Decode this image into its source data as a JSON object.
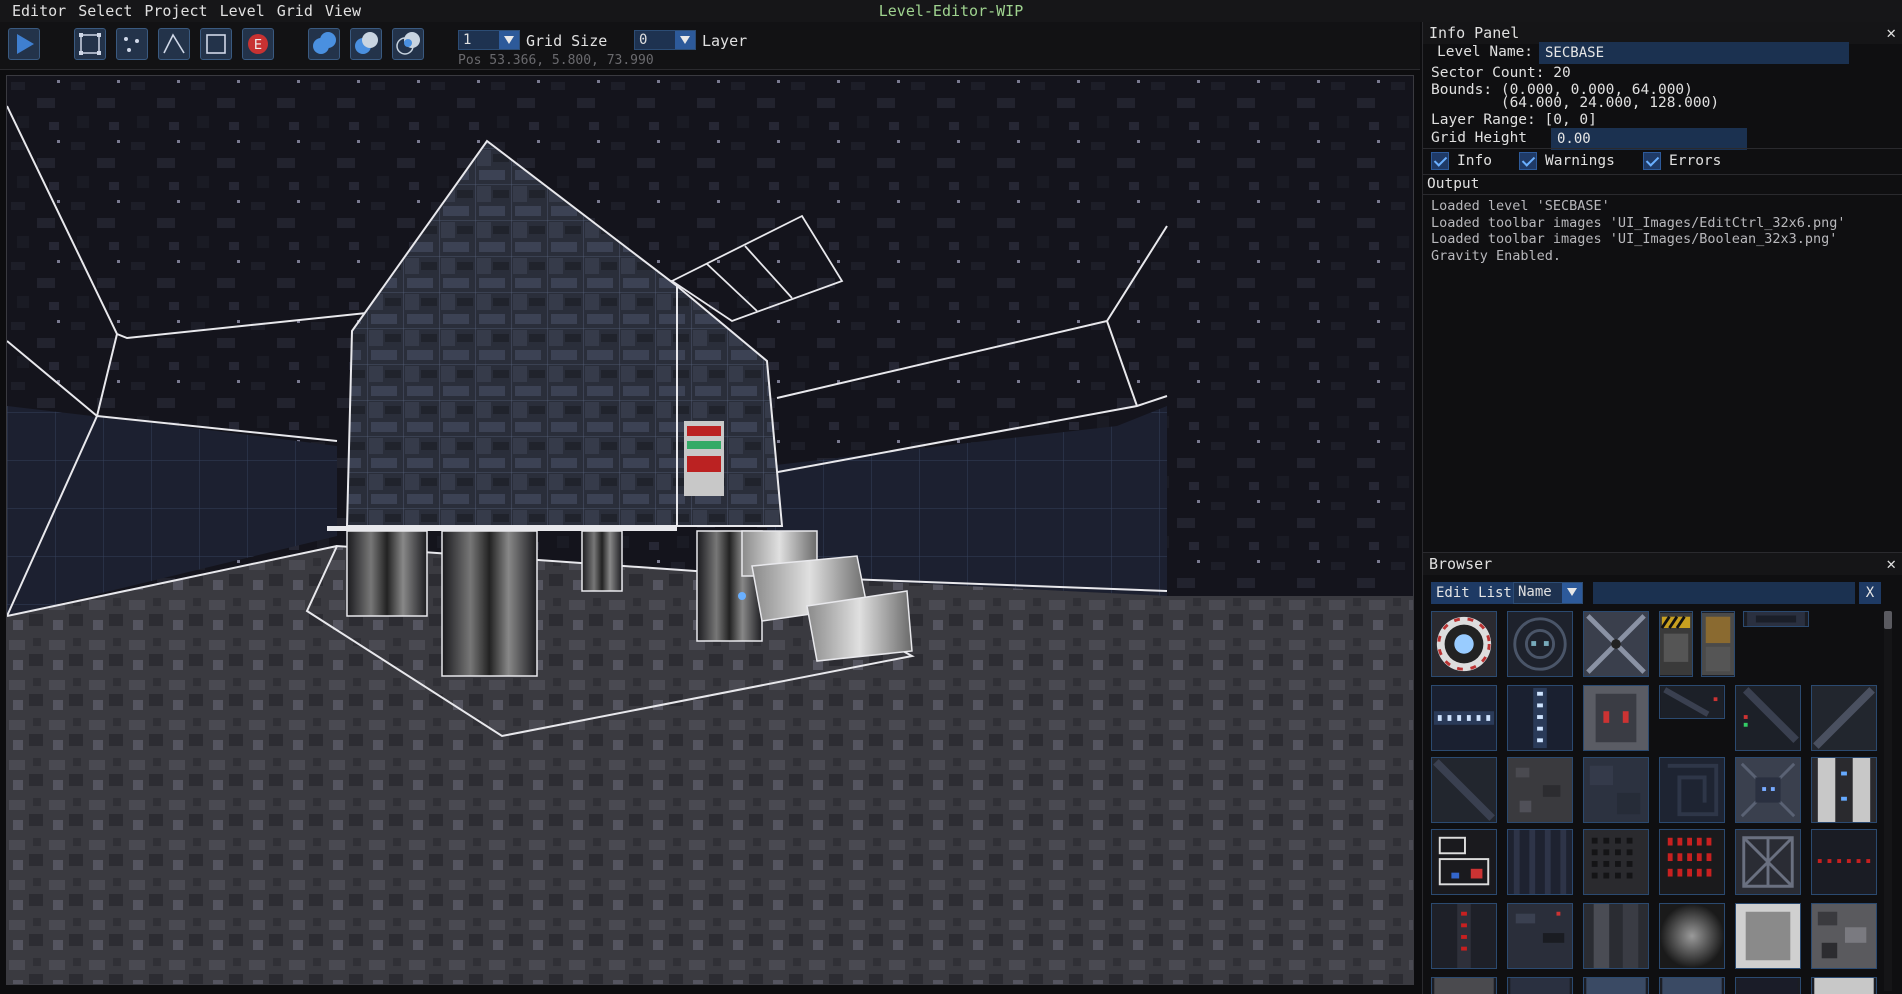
{
  "app": {
    "title": "Level-Editor-WIP"
  },
  "menu": [
    "Editor",
    "Select",
    "Project",
    "Level",
    "Grid",
    "View"
  ],
  "toolbar": {
    "grid_size_value": "1",
    "grid_size_label": "Grid Size",
    "layer_value": "0",
    "layer_label": "Layer",
    "position_readout": "Pos 53.366, 5.800, 73.990",
    "icons": [
      "play-icon",
      "select-sector-icon",
      "select-vertex-icon",
      "select-wall-icon",
      "draw-rect-icon",
      "entity-icon",
      "boolean-union-icon",
      "boolean-subtract-icon",
      "boolean-intersect-icon"
    ]
  },
  "info_panel": {
    "title": "Info Panel",
    "level_name_label": "Level Name:",
    "level_name_value": "SECBASE",
    "sector_count": "Sector Count: 20",
    "bounds_line1": "Bounds: (0.000, 0.000, 64.000)",
    "bounds_line2": "        (64.000, 24.000, 128.000)",
    "layer_range": "Layer Range: [0, 0]",
    "grid_height_label": "Grid Height",
    "grid_height_value": "0.00",
    "filters": {
      "info": "Info",
      "warnings": "Warnings",
      "errors": "Errors"
    },
    "output_title": "Output",
    "output_lines": [
      "Loaded level 'SECBASE'",
      "Loaded toolbar images 'UI_Images/EditCtrl_32x6.png'",
      "Loaded toolbar images 'UI_Images/Boolean_32x3.png'",
      "Gravity Enabled."
    ]
  },
  "browser": {
    "title": "Browser",
    "edit_list_label": "Edit List",
    "sort_value": "Name",
    "filter_value": "",
    "clear_label": "X"
  },
  "colors": {
    "accent": "#2d5a9a",
    "title_green": "#9fd38f",
    "field_bg": "#1b3150"
  }
}
